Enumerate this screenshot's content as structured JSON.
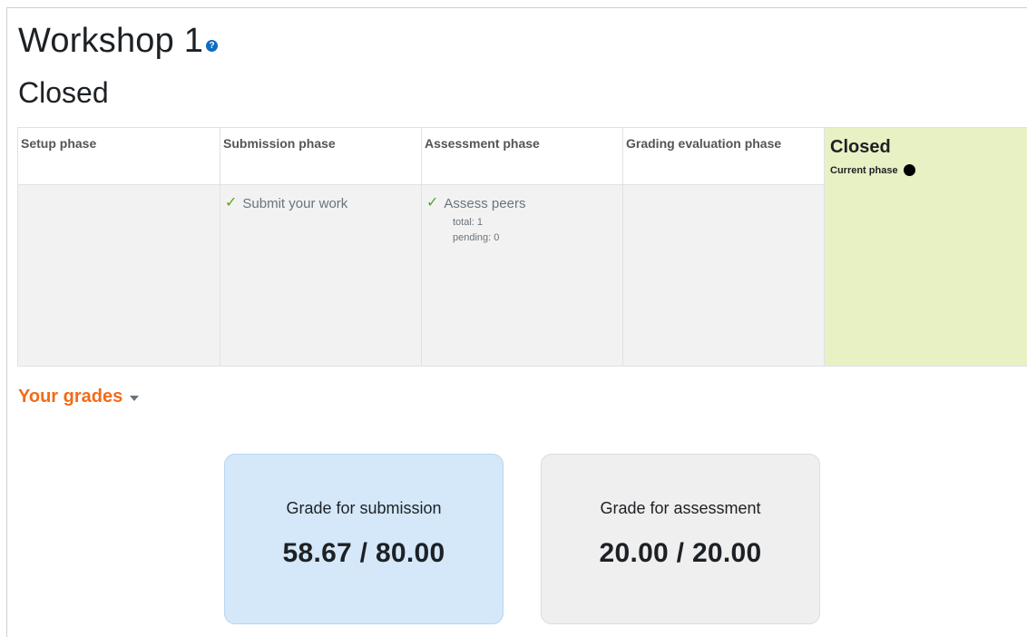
{
  "page": {
    "title": "Workshop 1",
    "current_phase_heading": "Closed"
  },
  "phases": [
    {
      "name": "Setup phase",
      "tasks": []
    },
    {
      "name": "Submission phase",
      "tasks": [
        {
          "label": "Submit your work",
          "done": true
        }
      ]
    },
    {
      "name": "Assessment phase",
      "tasks": [
        {
          "label": "Assess peers",
          "done": true,
          "details": [
            "total: 1",
            "pending: 0"
          ]
        }
      ]
    },
    {
      "name": "Grading evaluation phase",
      "tasks": []
    },
    {
      "name": "Closed",
      "current": true,
      "current_label": "Current phase"
    }
  ],
  "grades": {
    "section_label": "Your grades",
    "submission": {
      "caption": "Grade for submission",
      "value": "58.67 / 80.00"
    },
    "assessment": {
      "caption": "Grade for assessment",
      "value": "20.00 / 20.00"
    }
  },
  "colors": {
    "accent_orange": "#f36b16",
    "current_phase_bg": "#e7f1c4",
    "submission_card_bg": "#d4e8f9",
    "assessment_card_bg": "#efefef",
    "check_green": "#5aa328",
    "help_blue": "#0f6cbf"
  },
  "icons": {
    "help": "help-icon",
    "task_done": "check-icon",
    "current_phase": "dot-icon",
    "toggle": "caret-down-icon"
  }
}
